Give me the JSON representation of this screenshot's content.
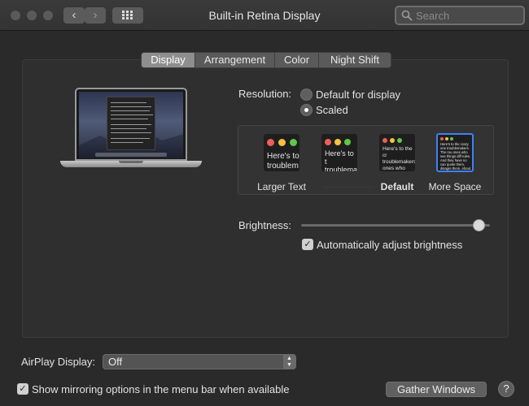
{
  "window": {
    "title": "Built-in Retina Display",
    "search_placeholder": "Search",
    "back_glyph": "‹",
    "forward_glyph": "›"
  },
  "tabs": [
    {
      "label": "Display",
      "active": true
    },
    {
      "label": "Arrangement",
      "active": false
    },
    {
      "label": "Color",
      "active": false
    },
    {
      "label": "Night Shift",
      "active": false
    }
  ],
  "resolution": {
    "label": "Resolution:",
    "options": [
      {
        "label": "Default for display",
        "selected": false
      },
      {
        "label": "Scaled",
        "selected": true
      }
    ]
  },
  "scaled_options": [
    {
      "label": "Larger Text",
      "preview_text": "Here's to troublem",
      "selected": false
    },
    {
      "label": "",
      "preview_text": "Here's to t troublema ones who",
      "selected": false
    },
    {
      "label": "Default",
      "preview_text": "Here's to the cr troublemakers. ones who see t rules. And they",
      "selected": false
    },
    {
      "label": "More Space",
      "preview_text": "Here's to the crazy one troublemakers. The rou ones who see things diff rules. And they have no can quote them, disagre them. About the only thi Because they change th",
      "selected": true
    }
  ],
  "brightness": {
    "label": "Brightness:",
    "level": 0.94,
    "auto_label": "Automatically adjust brightness",
    "auto_checked": true
  },
  "airplay": {
    "label": "AirPlay Display:",
    "value": "Off"
  },
  "mirroring": {
    "label": "Show mirroring options in the menu bar when available",
    "checked": true
  },
  "buttons": {
    "gather": "Gather Windows",
    "help": "?"
  },
  "colors": {
    "close": "#ec5f57",
    "minimize": "#f5c141",
    "zoom": "#5fc84a",
    "accent": "#3d82f7"
  }
}
